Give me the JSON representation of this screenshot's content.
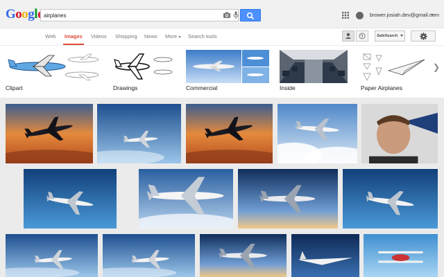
{
  "header": {
    "logo": [
      "G",
      "o",
      "o",
      "g",
      "l",
      "e"
    ],
    "logo_colors": [
      "#3369e8",
      "#d50f25",
      "#eeb211",
      "#3369e8",
      "#009925",
      "#d50f25"
    ],
    "query": "airplanes",
    "account_email": "brower.josiah.dev@gmail.com"
  },
  "nav": {
    "tabs": [
      "Web",
      "Images",
      "Videos",
      "Shopping",
      "News",
      "More",
      "Search tools"
    ],
    "safe_search": "SafeSearch"
  },
  "related": [
    {
      "label": "Clipart",
      "style": "clipart"
    },
    {
      "label": "Drawings",
      "style": "drawing"
    },
    {
      "label": "Commercial",
      "style": "commercial"
    },
    {
      "label": "Inside",
      "style": "inside"
    },
    {
      "label": "Paper Airplanes",
      "style": "paper"
    }
  ],
  "results": [
    {
      "scene": "sunset"
    },
    {
      "scene": "sky"
    },
    {
      "scene": "sunset"
    },
    {
      "scene": "clouds"
    },
    {
      "scene": "portrait"
    },
    {
      "scene": "bizjet"
    },
    {
      "scene": "jumbo"
    },
    {
      "scene": "dusk"
    },
    {
      "scene": "bizjet"
    },
    {
      "scene": "sky"
    },
    {
      "scene": "sky"
    },
    {
      "scene": "dusk"
    },
    {
      "scene": "concorde"
    },
    {
      "scene": "biplane"
    },
    {
      "scene": "airbus"
    }
  ],
  "colors": {
    "accent": "#dd4b39",
    "search_button": "#4d90fe",
    "grid_background": "#ebebeb"
  }
}
